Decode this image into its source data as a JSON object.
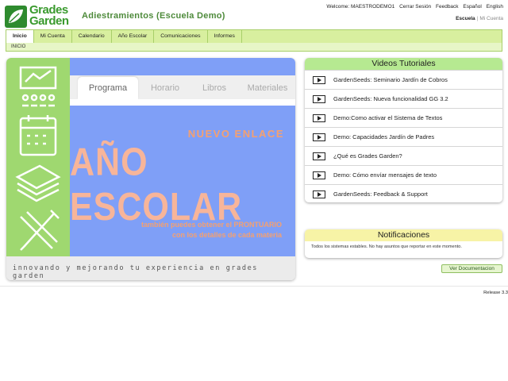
{
  "logo": {
    "line1": "Grades",
    "line2": "Garden"
  },
  "app_title": "Adiestramientos (Escuela Demo)",
  "top_links": {
    "welcome": "Welcome: MAESTRODEMO1",
    "logout": "Cerrar Sesión",
    "feedback": "Feedback",
    "spanish": "Español",
    "english": "English"
  },
  "school_switch": {
    "active": "Escuela",
    "separator": "|",
    "inactive": "Mi Cuenta"
  },
  "nav": {
    "items": [
      {
        "label": "Inicio"
      },
      {
        "label": "Mi Cuenta"
      },
      {
        "label": "Calendario"
      },
      {
        "label": "Año Escolar"
      },
      {
        "label": "Comunicaciones"
      },
      {
        "label": "Informes"
      }
    ],
    "breadcrumb": "INICIO"
  },
  "banner": {
    "tabs": [
      "Programa",
      "Horario",
      "Libros",
      "Materiales"
    ],
    "headline_small": "NUEVO ENLACE",
    "headline_large": "AÑO ESCOLAR",
    "promo_line1": "también puedes obtener el PRONTUARIO",
    "promo_line2": "con los detalles de cada materia",
    "footer": "innovando y mejorando tu experiencia en grades garden"
  },
  "videos": {
    "title": "Videos Tutoriales",
    "items": [
      "GardenSeeds: Seminario Jardín de Cobros",
      "GardenSeeds: Nueva funcionalidad GG 3.2",
      "Demo:Como activar el Sistema de Textos",
      "Demo: Capacidades Jardín de Padres",
      "¿Qué es Grades Garden?",
      "Demo: Cómo envíar mensajes de texto",
      "GardenSeeds: Feedback & Support"
    ]
  },
  "notifications": {
    "title": "Notificaciones",
    "text": "Todos los sistemas estables. No hay asuntos que reportar en este momento."
  },
  "doc_button": "Ver Documentacion",
  "release": "Release 3.3",
  "colors": {
    "brand_green": "#3a9a2e",
    "nav_bg": "#d8ef9f",
    "banner_blue": "#7f9ff7",
    "banner_green": "#9fd870",
    "accent_orange": "#f5a070"
  }
}
